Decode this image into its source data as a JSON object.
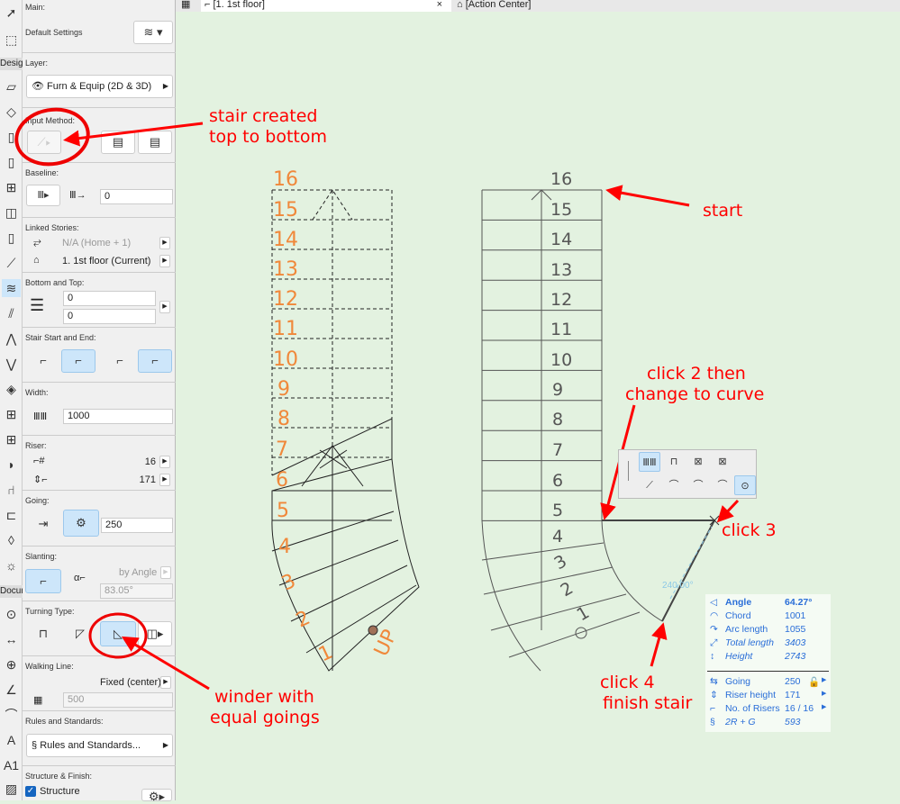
{
  "tabs": {
    "floor_tab": "[1. 1st floor]",
    "action_tab": "[Action Center]",
    "close": "×"
  },
  "toolbox": {
    "design_label": "Design",
    "document_label": "Document"
  },
  "panel": {
    "main": {
      "label": "Main:",
      "default_settings": "Default Settings"
    },
    "layer": {
      "label": "Layer:",
      "value": "Furn & Equip (2D & 3D)"
    },
    "input_method": {
      "label": "Input Method:"
    },
    "baseline": {
      "label": "Baseline:",
      "offset": "0"
    },
    "linked": {
      "label": "Linked Stories:",
      "top": "N/A (Home + 1)",
      "home": "1. 1st floor (Current)"
    },
    "bottom_top": {
      "label": "Bottom and Top:",
      "top": "0",
      "bottom": "0"
    },
    "start_end": {
      "label": "Stair Start and End:"
    },
    "width": {
      "label": "Width:",
      "value": "1000"
    },
    "riser": {
      "label": "Riser:",
      "count": "16",
      "height": "171"
    },
    "going": {
      "label": "Going:",
      "value": "250"
    },
    "slanting": {
      "label": "Slanting:",
      "mode": "by Angle",
      "angle": "83.05°"
    },
    "turning": {
      "label": "Turning Type:"
    },
    "walking": {
      "label": "Walking Line:",
      "mode": "Fixed (center)",
      "offset": "500"
    },
    "rules": {
      "label": "Rules and Standards:",
      "button": "Rules and Standards..."
    },
    "structure": {
      "label": "Structure & Finish:",
      "checkbox": "Structure",
      "checked": true
    }
  },
  "annotations": {
    "a1_l1": "stair created",
    "a1_l2": "top to bottom",
    "start": "start",
    "click2_l1": "click 2 then",
    "click2_l2": "change to curve",
    "click3": "click 3",
    "click4_l1": "click 4",
    "click4_l2": "finish stair",
    "winder_l1": "winder with",
    "winder_l2": "equal goings",
    "up": "UP",
    "angle_dim": "240.00°"
  },
  "left_stair_numbers": [
    "16",
    "15",
    "14",
    "13",
    "12",
    "11",
    "10",
    "9",
    "8",
    "7",
    "6",
    "5",
    "4",
    "3",
    "2",
    "1"
  ],
  "right_stair_numbers": [
    "16",
    "15",
    "14",
    "13",
    "12",
    "11",
    "10",
    "9",
    "8",
    "7",
    "6",
    "5",
    "4",
    "3",
    "2",
    "1"
  ],
  "info": {
    "rows": [
      {
        "icon": "angle-icon",
        "label": "Angle",
        "value": "64.27°",
        "style": "bold"
      },
      {
        "icon": "chord-icon",
        "label": "Chord",
        "value": "1001",
        "style": "normal"
      },
      {
        "icon": "arc-length-icon",
        "label": "Arc length",
        "value": "1055",
        "style": "normal"
      },
      {
        "icon": "total-length-icon",
        "label": "Total length",
        "value": "3403",
        "style": "italic"
      },
      {
        "icon": "height-icon",
        "label": "Height",
        "value": "2743",
        "style": "italic"
      }
    ],
    "rows2": [
      {
        "icon": "going-icon",
        "label": "Going",
        "value": "250",
        "locked": true
      },
      {
        "icon": "riser-height-icon",
        "label": "Riser height",
        "value": "171"
      },
      {
        "icon": "risers-icon",
        "label": "No. of Risers",
        "value": "16 / 16"
      },
      {
        "icon": "rule-icon",
        "label": "2R + G",
        "value": "593",
        "style": "italic"
      }
    ]
  },
  "colors": {
    "canvas": "#e3f2e0",
    "annotation": "#ff0000",
    "step_numbers": "#f0883a",
    "info_text": "#2a6ed8"
  }
}
